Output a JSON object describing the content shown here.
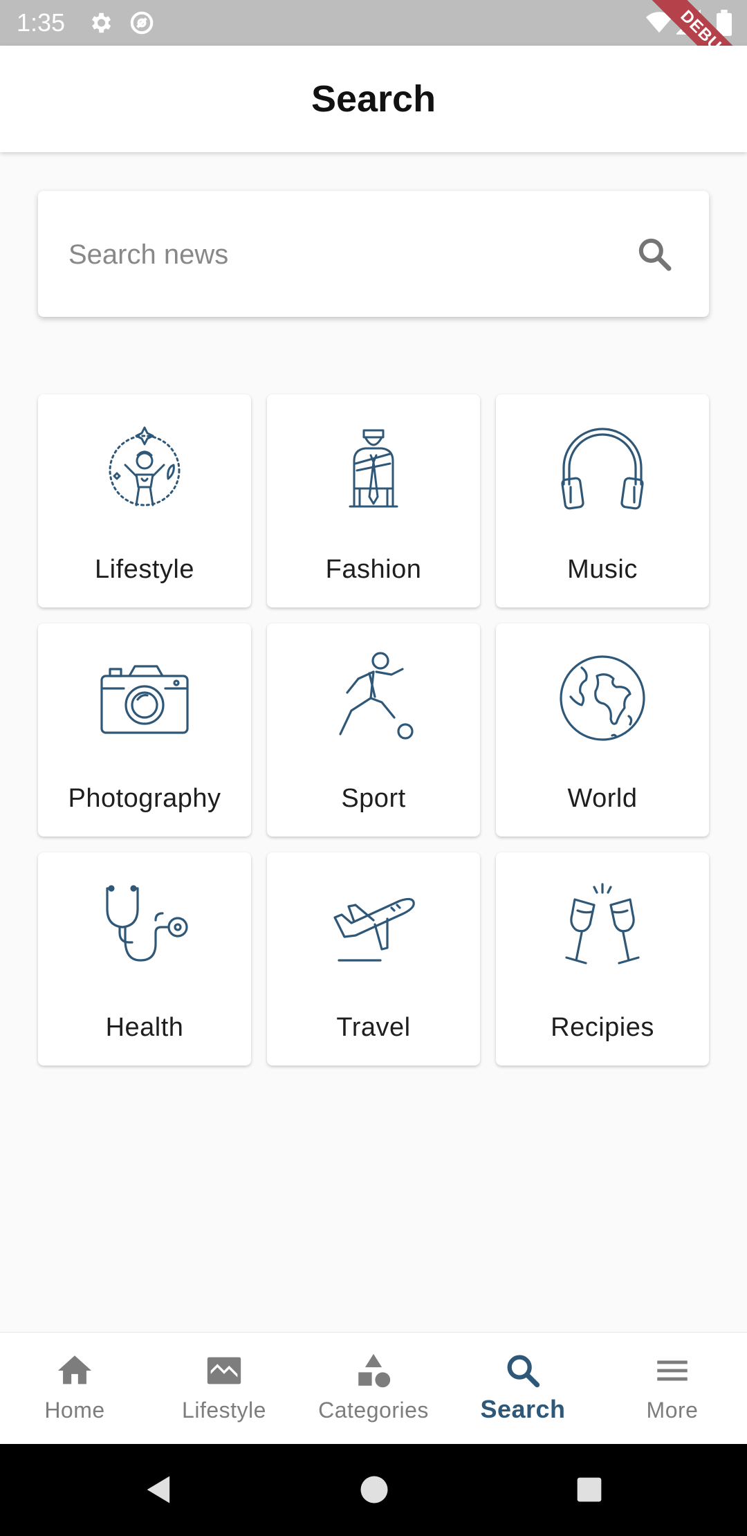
{
  "status_bar": {
    "time": "1:35",
    "icons": [
      "settings-icon",
      "sync-icon",
      "wifi-icon",
      "signal-icon",
      "battery-icon"
    ],
    "debug_banner": "DEBUG"
  },
  "app_bar": {
    "title": "Search"
  },
  "search": {
    "placeholder": "Search news",
    "value": "",
    "icon": "search-icon"
  },
  "categories": [
    {
      "label": "Lifestyle",
      "icon": "lifestyle-icon"
    },
    {
      "label": "Fashion",
      "icon": "fashion-icon"
    },
    {
      "label": "Music",
      "icon": "headphones-icon"
    },
    {
      "label": "Photography",
      "icon": "camera-icon"
    },
    {
      "label": "Sport",
      "icon": "soccer-player-icon"
    },
    {
      "label": "World",
      "icon": "globe-icon"
    },
    {
      "label": "Health",
      "icon": "stethoscope-icon"
    },
    {
      "label": "Travel",
      "icon": "airplane-icon"
    },
    {
      "label": "Recipies",
      "icon": "champagne-glasses-icon"
    }
  ],
  "bottom_nav": {
    "items": [
      {
        "label": "Home",
        "icon": "home-icon",
        "active": false
      },
      {
        "label": "Lifestyle",
        "icon": "image-icon",
        "active": false
      },
      {
        "label": "Categories",
        "icon": "shapes-icon",
        "active": false
      },
      {
        "label": "Search",
        "icon": "search-icon",
        "active": true
      },
      {
        "label": "More",
        "icon": "menu-icon",
        "active": false
      }
    ]
  },
  "colors": {
    "accent": "#2e5778",
    "icon_stroke": "#2e5778",
    "inactive": "#7d7d7d",
    "status_bar": "#bdbdbd",
    "debug_ribbon": "#b5424a"
  },
  "system_nav": {
    "buttons": [
      "back-icon",
      "home-circle-icon",
      "recents-icon"
    ]
  }
}
